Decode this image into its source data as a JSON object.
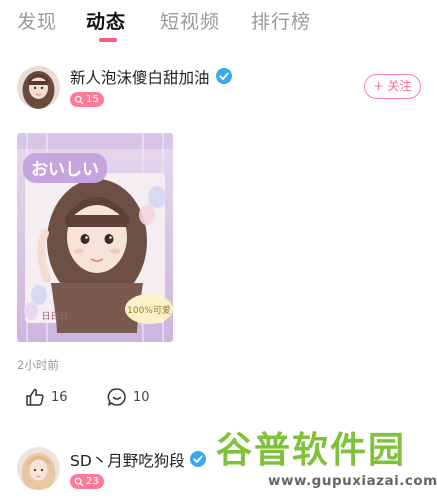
{
  "tabs": [
    {
      "label": "发现",
      "active": false
    },
    {
      "label": "动态",
      "active": true
    },
    {
      "label": "短视频",
      "active": false
    },
    {
      "label": "排行榜",
      "active": false
    }
  ],
  "posts": [
    {
      "user": "新人泡沫傻白甜加油",
      "verified": true,
      "level": "15",
      "follow_label": "+ 关注",
      "image_text": {
        "headline": "おいしい",
        "sticker": "100%可爱",
        "candy": "日日日"
      },
      "time": "2小时前",
      "likes": "16",
      "comments": "10"
    },
    {
      "user": "SD丶月野吃狗段",
      "verified": true,
      "level": "23"
    }
  ],
  "watermark": {
    "title": "谷普软件园",
    "url": "www.gupuxiazai.com"
  },
  "colors": {
    "accent": "#ff5b7f",
    "badge": "#ff7b98",
    "verified": "#38a9ee",
    "watermark_green": "#7fc23a"
  },
  "icons": [
    "verified-icon",
    "level-icon",
    "like-icon",
    "comment-icon"
  ]
}
